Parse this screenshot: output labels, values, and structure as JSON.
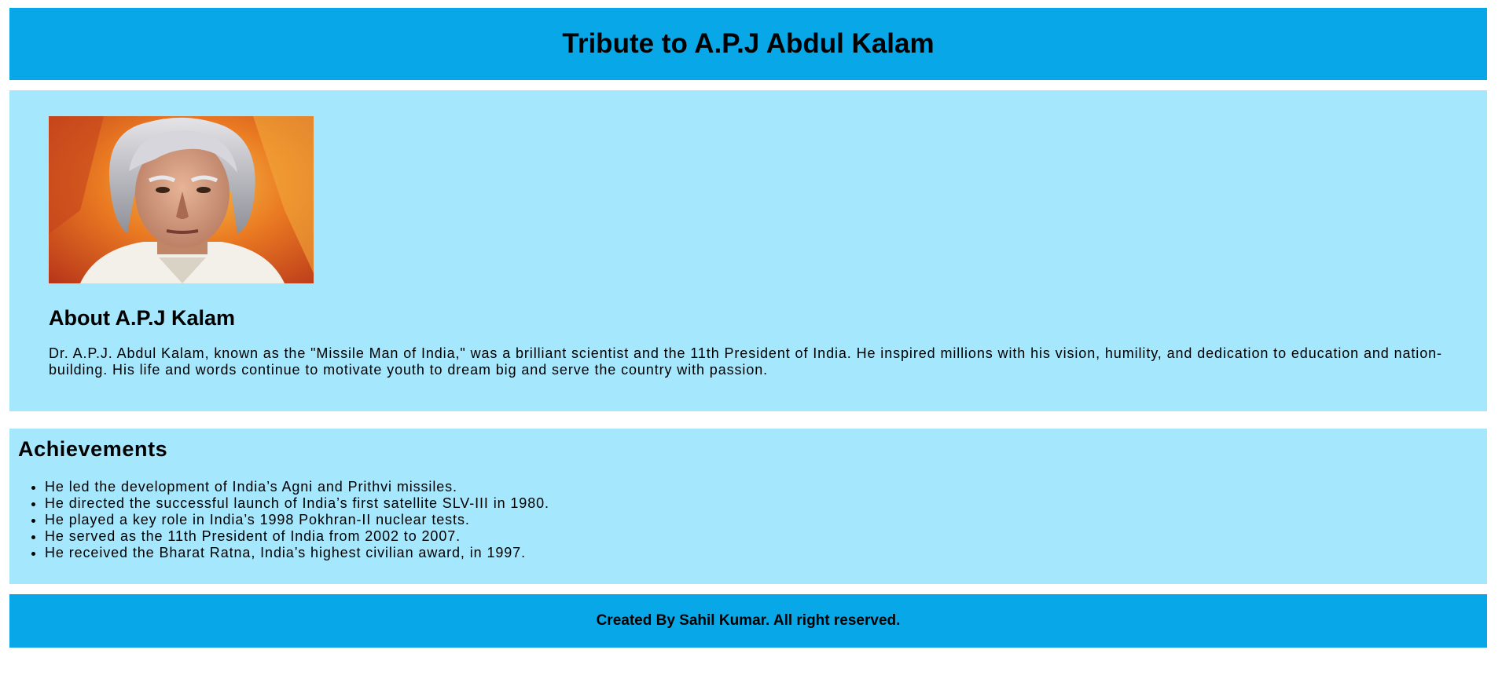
{
  "header": {
    "title": "Tribute to A.P.J Abdul Kalam"
  },
  "about": {
    "heading": "About A.P.J Kalam",
    "paragraph": "Dr. A.P.J. Abdul Kalam, known as the \"Missile Man of India,\" was a brilliant scientist and the 11th President of India. He inspired millions with his vision, humility, and dedication to education and nation-building. His life and words continue to motivate youth to dream big and serve the country with passion."
  },
  "achievements": {
    "heading": "Achievements",
    "items": [
      "He led the development of India’s Agni and Prithvi missiles.",
      "He directed the successful launch of India’s first satellite SLV-III in 1980.",
      "He played a key role in India’s 1998 Pokhran-II nuclear tests.",
      "He served as the 11th President of India from 2002 to 2007.",
      "He received the Bharat Ratna, India’s highest civilian award, in 1997."
    ]
  },
  "footer": {
    "text": "Created By Sahil Kumar. All right reserved."
  },
  "colors": {
    "header_bg": "#08a8e8",
    "section_bg": "#a5e7fd",
    "footer_bg": "#08a8e8"
  }
}
